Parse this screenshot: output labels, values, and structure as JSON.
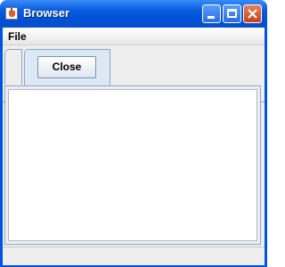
{
  "window": {
    "title": "Browser"
  },
  "menubar": {
    "items": [
      {
        "label": "File"
      }
    ]
  },
  "tabs": {
    "tab_button_label": "Close"
  },
  "icons": {
    "app": "java-icon",
    "minimize": "minimize-icon",
    "maximize": "maximize-icon",
    "close": "close-icon"
  },
  "colors": {
    "titlebar": "#0054e3",
    "close_button": "#c8401a",
    "tab_active": "#dde8f5",
    "content_bg": "#ffffff"
  }
}
